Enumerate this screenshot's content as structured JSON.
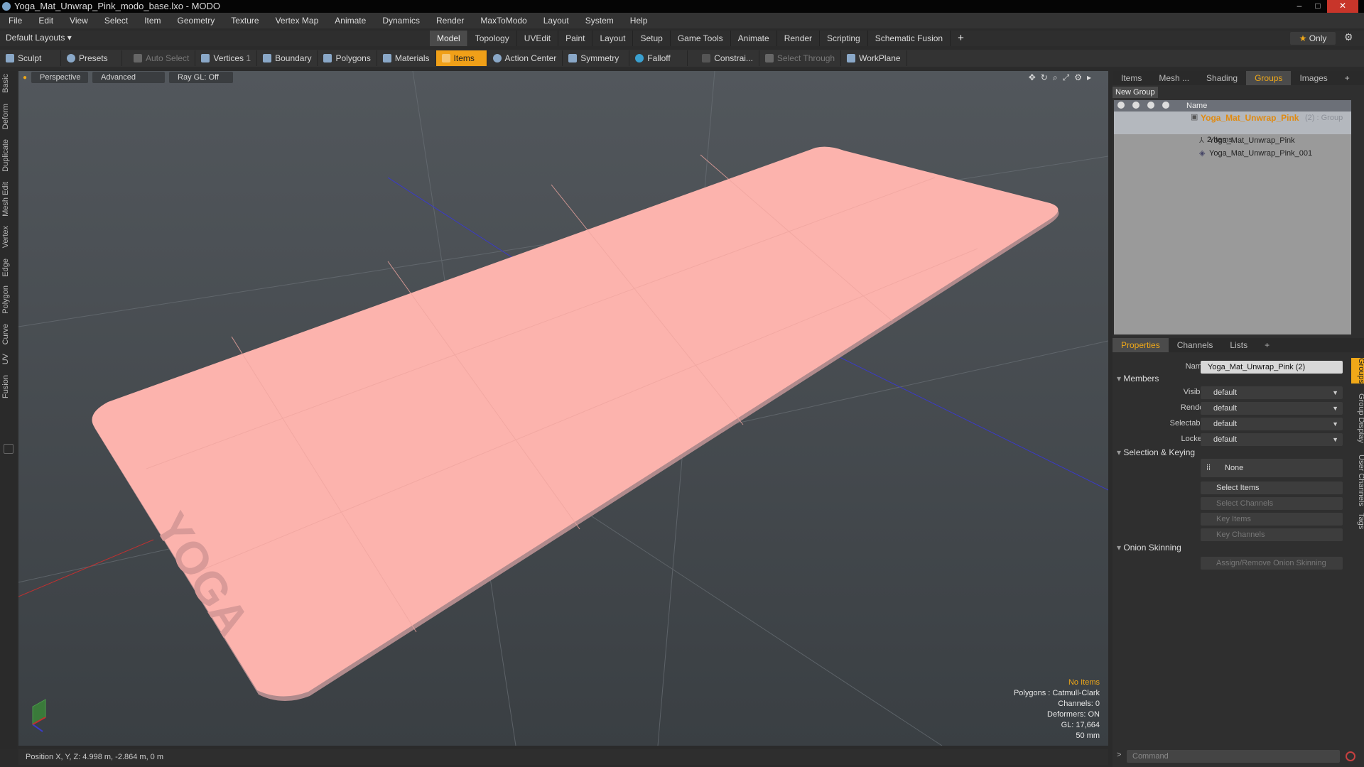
{
  "window": {
    "title": "Yoga_Mat_Unwrap_Pink_modo_base.lxo - MODO",
    "controls": [
      "–",
      "□",
      "✕"
    ]
  },
  "menubar": [
    "File",
    "Edit",
    "View",
    "Select",
    "Item",
    "Geometry",
    "Texture",
    "Vertex Map",
    "Animate",
    "Dynamics",
    "Render",
    "MaxToModo",
    "Layout",
    "System",
    "Help"
  ],
  "layout_selector": "Default Layouts ▾",
  "main_tabs": [
    "Model",
    "Topology",
    "UVEdit",
    "Paint",
    "Layout",
    "Setup",
    "Game Tools",
    "Animate",
    "Render",
    "Scripting",
    "Schematic Fusion"
  ],
  "active_main_tab": "Model",
  "only_label": "Only",
  "toolbar": {
    "sculpt": "Sculpt",
    "presets": "Presets",
    "auto_select": "Auto Select",
    "vertices": "Vertices",
    "vertices_count": "1",
    "boundary": "Boundary",
    "polygons": "Polygons",
    "materials": "Materials",
    "items": "Items",
    "action_center": "Action Center",
    "symmetry": "Symmetry",
    "falloff": "Falloff",
    "constraints": "Constrai...",
    "select_through": "Select Through",
    "workplane": "WorkPlane"
  },
  "left_tabs": [
    "Basic",
    "Deform",
    "Duplicate",
    "Mesh Edit",
    "Vertex",
    "Edge",
    "Polygon",
    "Curve",
    "UV",
    "Fusion"
  ],
  "viewport": {
    "view_mode": "Perspective",
    "shading": "Advanced",
    "raygl": "Ray GL: Off",
    "mat_text": "YOGA",
    "info": {
      "selection": "No Items",
      "polygons": "Polygons : Catmull-Clark",
      "channels": "Channels: 0",
      "deformers": "Deformers: ON",
      "gl": "GL: 17,664",
      "lens": "50 mm"
    },
    "colors": {
      "mat": "#fcb3ad",
      "mat_edge": "#b08a8c",
      "axis_blue": "#3a3ac8",
      "axis_red": "#c03030"
    }
  },
  "status": {
    "position": "Position X, Y, Z:  4.998 m, -2.864 m, 0 m"
  },
  "groups_panel": {
    "tabs": [
      "Items",
      "Mesh ...",
      "Shading",
      "Groups",
      "Images"
    ],
    "active_tab": "Groups",
    "new_group": "New Group",
    "col_name": "Name",
    "group_name": "Yoga_Mat_Unwrap_Pink",
    "group_suffix": "(2) : Group",
    "group_count": "2 Items",
    "items": [
      "Yoga_Mat_Unwrap_Pink",
      "Yoga_Mat_Unwrap_Pink_001"
    ]
  },
  "properties": {
    "tabs": [
      "Properties",
      "Channels",
      "Lists"
    ],
    "active_tab": "Properties",
    "name_label": "Name",
    "name_value": "Yoga_Mat_Unwrap_Pink (2)",
    "members_section": "Members",
    "visible_label": "Visible",
    "visible_value": "default",
    "render_label": "Render",
    "render_value": "default",
    "selectable_label": "Selectable",
    "selectable_value": "default",
    "locked_label": "Locked",
    "locked_value": "default",
    "selection_section": "Selection & Keying",
    "none_label": "None",
    "select_items": "Select Items",
    "select_channels": "Select Channels",
    "key_items": "Key Items",
    "key_channels": "Key Channels",
    "onion_section": "Onion Skinning",
    "onion_button": "Assign/Remove Onion Skinning",
    "side_tabs": [
      "Groups",
      "Group Display",
      "User Channels",
      "Tags"
    ]
  },
  "command": {
    "placeholder": "Command",
    "prompt": ">"
  }
}
